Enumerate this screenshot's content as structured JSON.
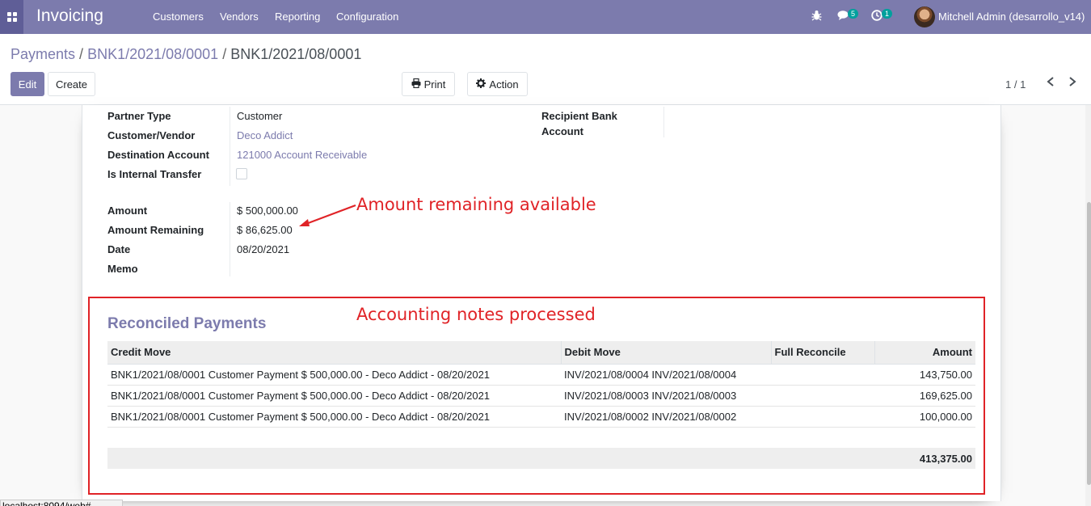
{
  "navbar": {
    "brand": "Invoicing",
    "menu": [
      "Customers",
      "Vendors",
      "Reporting",
      "Configuration"
    ],
    "messages_count": "5",
    "activities_count": "1",
    "user": "Mitchell Admin (desarrollo_v14)",
    "bug_icon": "bug-icon",
    "chat_icon": "chat-icon",
    "clock_icon": "clock-icon"
  },
  "breadcrumb": {
    "root": "Payments",
    "parent": "BNK1/2021/08/0001",
    "current": "BNK1/2021/08/0001",
    "sep": "/"
  },
  "toolbar": {
    "edit": "Edit",
    "create": "Create",
    "print": "Print",
    "action": "Action",
    "pager": "1 / 1"
  },
  "form": {
    "partner_type_label": "Partner Type",
    "partner_type": "Customer",
    "customer_vendor_label": "Customer/Vendor",
    "customer_vendor": "Deco Addict",
    "destination_account_label": "Destination Account",
    "destination_account": "121000 Account Receivable",
    "internal_transfer_label": "Is Internal Transfer",
    "recipient_bank_label_1": "Recipient Bank",
    "recipient_bank_label_2": "Account",
    "amount_label": "Amount",
    "amount": "$ 500,000.00",
    "amount_remaining_label": "Amount Remaining",
    "amount_remaining": "$ 86,625.00",
    "date_label": "Date",
    "date": "08/20/2021",
    "memo_label": "Memo"
  },
  "annotations": {
    "remaining": "Amount remaining available",
    "notes": "Accounting notes processed"
  },
  "reconciled": {
    "title": "Reconciled Payments",
    "columns": [
      "Credit Move",
      "Debit Move",
      "Full Reconcile",
      "Amount"
    ],
    "rows": [
      {
        "credit": "BNK1/2021/08/0001 Customer Payment $ 500,000.00 - Deco Addict - 08/20/2021",
        "debit": "INV/2021/08/0004 INV/2021/08/0004",
        "full": "",
        "amount": "143,750.00"
      },
      {
        "credit": "BNK1/2021/08/0001 Customer Payment $ 500,000.00 - Deco Addict - 08/20/2021",
        "debit": "INV/2021/08/0003 INV/2021/08/0003",
        "full": "",
        "amount": "169,625.00"
      },
      {
        "credit": "BNK1/2021/08/0001 Customer Payment $ 500,000.00 - Deco Addict - 08/20/2021",
        "debit": "INV/2021/08/0002 INV/2021/08/0002",
        "full": "",
        "amount": "100,000.00"
      }
    ],
    "total": "413,375.00"
  },
  "status_url": "localhost:8094/web#",
  "colors": {
    "brand": "#7c7bad",
    "annotation": "#e02327",
    "badge": "#00a09d"
  }
}
